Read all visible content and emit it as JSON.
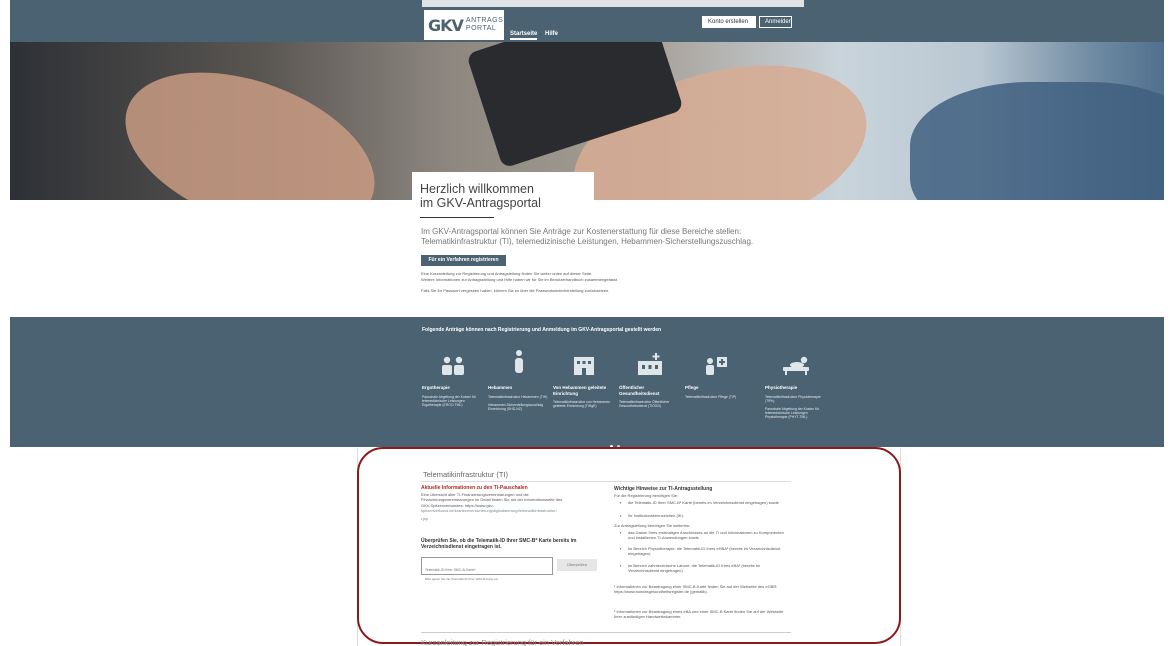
{
  "header": {
    "logo_mark": "GKV",
    "logo_text_1": "ANTRAGS",
    "logo_text_2": "PORTAL",
    "nav_home": "Startseite",
    "nav_help": "Hilfe",
    "btn_account": "Konto erstellen",
    "btn_login": "Anmelden"
  },
  "welcome": {
    "line1": "Herzlich willkommen",
    "line2": "im GKV-Antragsportal",
    "intro": "Im GKV-Antragsportal können Sie Anträge zur Kostenerstattung für diese Bereiche stellen: Telematikinfrastruktur (TI), telemedizinische Leistungen, Hebammen-Sicherstellungszuschlag.",
    "reg_button": "Für ein Verfahren registrieren",
    "small1": "Eine Kurzanleitung zur Registrierung und Antragstellung finden Sie weiter unten auf dieser Seite.",
    "small2": "Weitere Informationen zur Antragsstellung und Hilfe haben wir für Sie im Benutzerhandbuch zusammengefasst.",
    "small3": "Falls Sie Ihr Passwort vergessen haben, können Sie es über die Passwortwiederherstellung zurücksetzen."
  },
  "band": {
    "title": "Folgende Anträge können nach Registrierung und Anmeldung im GKV-Antragsportal gestellt werden",
    "categories": [
      {
        "icon": "people-icon",
        "title": "Ergotherapie",
        "desc": "Pauschale Abgeltung der Kosten für telemedizinische Leistungen Ergotherapie (ERGO-TML)"
      },
      {
        "icon": "midwife-icon",
        "title": "Hebammen",
        "desc": "Telematikinfrastruktur Hebammen (TIH)",
        "desc2": "Hebammen-Sicherstellungszuschlag Einreichung (SHD-NZ)"
      },
      {
        "icon": "building-icon",
        "title": "Von Hebammen geleitete Einrichtung",
        "desc": "Telematikinfrastruktur von Hebammen geleitete Einrichtung (TIHgE)"
      },
      {
        "icon": "health-office-icon",
        "title": "Öffentlicher Gesundheitsdienst",
        "desc": "Telematikinfrastruktur Öffentlicher Gesundheitsdienst (TIÖGD)"
      },
      {
        "icon": "care-icon",
        "title": "Pflege",
        "desc": "Telematikinfrastruktur Pflege (TIP)"
      },
      {
        "icon": "physio-icon",
        "title": "Physiotherapie",
        "desc": "Telematikinfrastruktur Physiotherapie (TIPh)",
        "desc2": "Pauschale Abgeltung der Kosten für telemedizinische Leistungen Physiotherapie (PHYT-TML)"
      }
    ]
  },
  "ti": {
    "title": "Telematikinfrastruktur (TI)",
    "red_head": "Aktuelle Informationen zu den TI-Pauschalen",
    "l1": "Eine Übersicht aller TI-Finanzierungsvereinbarungen und die",
    "l2": "Finanzierungsvereinbarungen im Detail finden Sie auf der Informationsseite des",
    "l3": "GKV-Spitzenverbandes: https://www.gkv-",
    "l4": "spitzenverband.de/krankenversicherung/digitalisierung/telematikinfrastruktur/",
    "l5": "i.jsp",
    "check_head": "Überprüfen Sie, ob die Telematik-ID Ihrer SMC-B* Karte bereits im Verzeichnisdienst eingetragen ist.",
    "input_placeholder": "Telematik-ID Ihrer SMC-B-Karte*",
    "check_button": "Überprüfen",
    "input_hint": "Bitte geben Sie die Telematik-ID Ihrer SMC-B-Karte ein.",
    "right_head": "Wichtige Hinweise zur TI-Antragsstellung",
    "r1": "Für die Registrierung benötigen Sie:",
    "b1": "die Telematik-ID Ihrer SMC-B¹ Karte (bereits im Verzeichnisdienst eingetragen) sowie",
    "b2": "Ihr Institutionskennzeichen (IK).",
    "r2": "Zur Antragstellung benötigen Sie weiterhin:",
    "b3": "das Datum Ihres erstmaligen Anschlusses an die TI und Informationen zu Komponenten und installierten TI-Anwendungen sowie",
    "b4": "im Bereich Physiotherapie: die Telematik-ID Ihres eHBA² (bereits im Verzeichnisdienst eingetragen)",
    "b5": "im Bereich zahntechnische Labore: die Telematik-ID Ihres eBA² (bereits im Verzeichnisdienst eingetragen)",
    "f1": "¹ Informationen zur Beantragung einer SMC-B-Karte finden Sie auf der Webseite des eGBR: https://www.bundesgesundheitsregister.de (gematik).",
    "f2": "² Informationen zur Beantragung eines eBA und einer SMC-B Karte finden Sie auf der Webseite Ihrer zuständigen Handwerkskammer.",
    "next_title": "Kurzanleitung zur Registrierung für ein Verfahren"
  }
}
